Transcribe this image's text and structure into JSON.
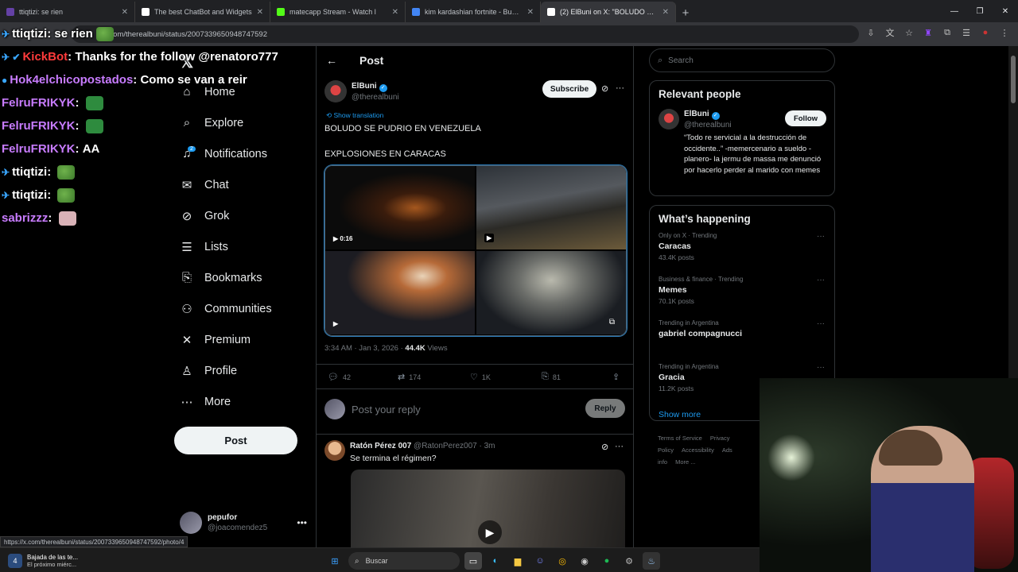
{
  "browser": {
    "tabs": [
      {
        "title": "ttiqtizi: se rien",
        "color": "#6441a5"
      },
      {
        "title": "The best ChatBot and Widgets",
        "color": "#ffffff"
      },
      {
        "title": "matecapp Stream - Watch l",
        "color": "#53fc18"
      },
      {
        "title": "kim kardashian fortnite - Busca",
        "color": "#4285f4"
      },
      {
        "title": "(2) ElBuni on X: \"BOLUDO SE P",
        "color": "#ffffff"
      }
    ],
    "url": "x.com/therealbuni/status/2007339650948747592"
  },
  "chat": [
    {
      "user": "ttiqtizi",
      "color": "#ffffff",
      "badge": "✈",
      "text": "se rien",
      "emote": "pepe"
    },
    {
      "user": "KickBot",
      "color": "#ff3b3b",
      "badge": "✈ ✔",
      "text": "Thanks for the follow @renatoro777",
      "emote": ""
    },
    {
      "user": "Hok4elchicopostados",
      "color": "#c87cff",
      "badge": "●",
      "text": "Como se van a reir",
      "emote": ""
    },
    {
      "user": "FelruFRIKYK",
      "color": "#c87cff",
      "badge": "",
      "text": "",
      "emote": "box"
    },
    {
      "user": "FelruFRIKYK",
      "color": "#c87cff",
      "badge": "",
      "text": "",
      "emote": "box"
    },
    {
      "user": "FelruFRIKYK",
      "color": "#c87cff",
      "badge": "",
      "text": "AA",
      "emote": ""
    },
    {
      "user": "ttiqtizi",
      "color": "#ffffff",
      "badge": "✈",
      "text": "",
      "emote": "pepe"
    },
    {
      "user": "ttiqtizi",
      "color": "#ffffff",
      "badge": "✈",
      "text": "",
      "emote": "pepe"
    },
    {
      "user": "sabrizzz",
      "color": "#c87cff",
      "badge": "",
      "text": "",
      "emote": "pink"
    }
  ],
  "nav": {
    "items": [
      {
        "label": "Home",
        "icon": "home-icon",
        "glyph": "⌂"
      },
      {
        "label": "Explore",
        "icon": "search-icon",
        "glyph": "⌕"
      },
      {
        "label": "Notifications",
        "icon": "bell-icon",
        "glyph": "♫",
        "badge": "2"
      },
      {
        "label": "Chat",
        "icon": "mail-icon",
        "glyph": "✉"
      },
      {
        "label": "Grok",
        "icon": "grok-icon",
        "glyph": "⊘"
      },
      {
        "label": "Lists",
        "icon": "list-icon",
        "glyph": "☰"
      },
      {
        "label": "Bookmarks",
        "icon": "bookmark-icon",
        "glyph": "⎘"
      },
      {
        "label": "Communities",
        "icon": "people-icon",
        "glyph": "⚇"
      },
      {
        "label": "Premium",
        "icon": "x-icon",
        "glyph": "✕"
      },
      {
        "label": "Profile",
        "icon": "person-icon",
        "glyph": "♙"
      },
      {
        "label": "More",
        "icon": "more-circle-icon",
        "glyph": "⋯"
      }
    ],
    "post_label": "Post",
    "me": {
      "name": "pepufor",
      "handle": "@joacomendez5"
    }
  },
  "post": {
    "header": "Post",
    "author": {
      "name": "ElBuni",
      "handle": "@therealbuni"
    },
    "subscribe_label": "Subscribe",
    "show_translation": "Show translation",
    "text_line1": "BOLUDO SE PUDRIO EN VENEZUELA",
    "text_line2": "EXPLOSIONES EN CARACAS",
    "video_duration": "0:16",
    "time": "3:34 AM · Jan 3, 2026 · ",
    "views": "44.4K",
    "views_label": " Views",
    "replies": "42",
    "reposts": "174",
    "likes": "1K",
    "bookmarks": "81",
    "reply_placeholder": "Post your reply",
    "reply_label": "Reply"
  },
  "reply": {
    "name": "Ratón Pérez 007",
    "handle": "@RatonPerez007 · 3m",
    "text": "Se termina el régimen?"
  },
  "right": {
    "search_placeholder": "Search",
    "relevant_title": "Relevant people",
    "person": {
      "name": "ElBuni",
      "handle": "@therealbuni",
      "follow_label": "Follow",
      "bio": "“Todo re servicial a la destrucción de occidente..” -memercenario a sueldo -planero- la jermu de massa me denunció por hacerlo perder al marido con memes"
    },
    "happening_title": "What’s happening",
    "trends": [
      {
        "context": "Only on X · Trending",
        "title": "Caracas",
        "count": "43.4K posts"
      },
      {
        "context": "Business & finance · Trending",
        "title": "Memes",
        "count": "70.1K posts"
      },
      {
        "context": "Trending in Argentina",
        "title": "gabriel compagnucci",
        "count": ""
      },
      {
        "context": "Trending in Argentina",
        "title": "Gracia",
        "count": "11.2K posts"
      }
    ],
    "show_more": "Show more",
    "footer": [
      "Terms of Service",
      "Privacy Policy",
      "Accessibility",
      "Ads info",
      "More ..."
    ]
  },
  "status_url": "https://x.com/therealbuni/status/2007339650948747592/photo/4",
  "taskbar": {
    "notif_title": "Bajada de las te...",
    "notif_sub": "El próximo miérc...",
    "notif_badge": "4",
    "search_placeholder": "Buscar"
  }
}
